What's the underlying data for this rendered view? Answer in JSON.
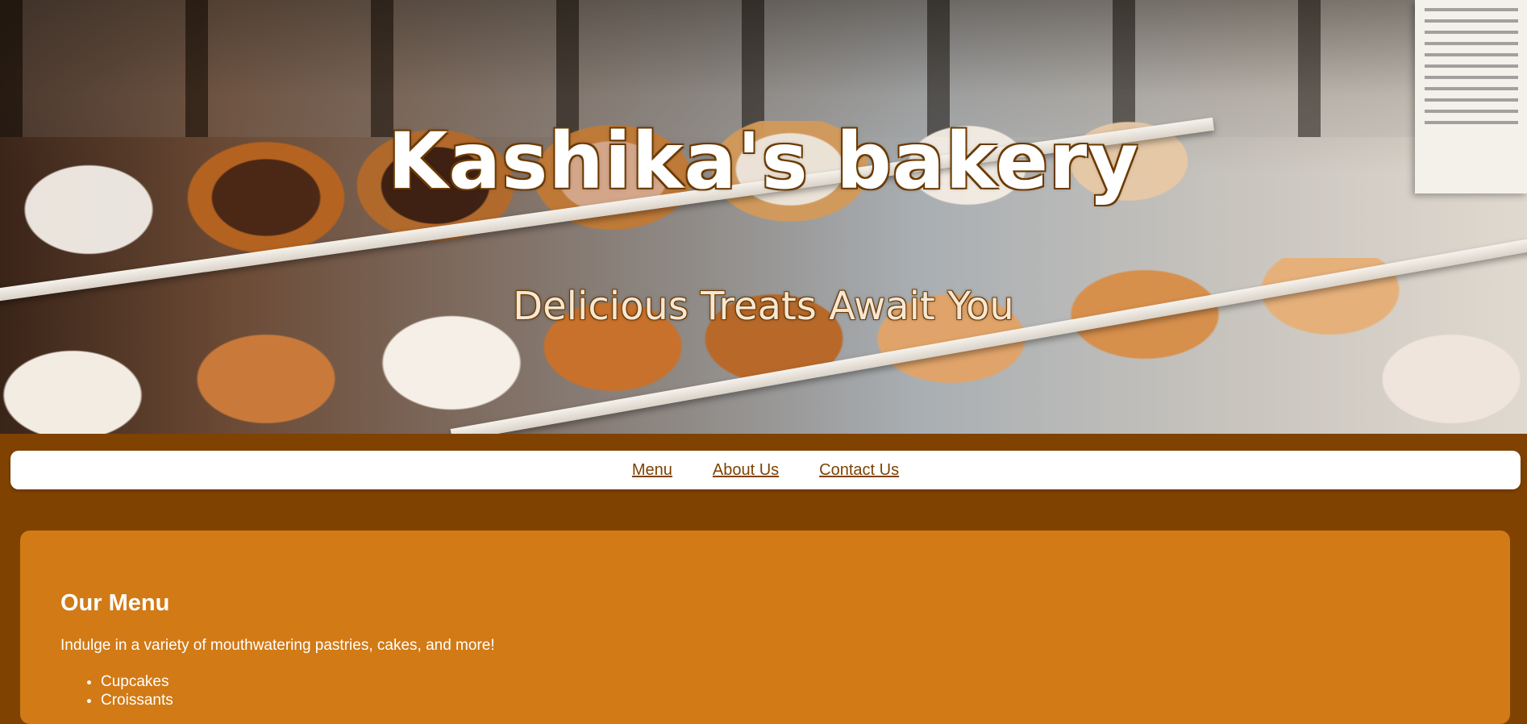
{
  "hero": {
    "title": "Kashika's bakery",
    "subtitle": "Delicious Treats Await You"
  },
  "nav": {
    "items": [
      {
        "label": "Menu"
      },
      {
        "label": "About Us"
      },
      {
        "label": "Contact Us"
      }
    ]
  },
  "menu_section": {
    "heading": "Our Menu",
    "description": "Indulge in a variety of mouthwatering pastries, cakes, and more!",
    "items": [
      "Cupcakes",
      "Croissants"
    ]
  },
  "colors": {
    "page_background": "#7f4200",
    "content_background": "#d17a16",
    "nav_background": "#ffffff",
    "link_color": "#7f4200"
  }
}
